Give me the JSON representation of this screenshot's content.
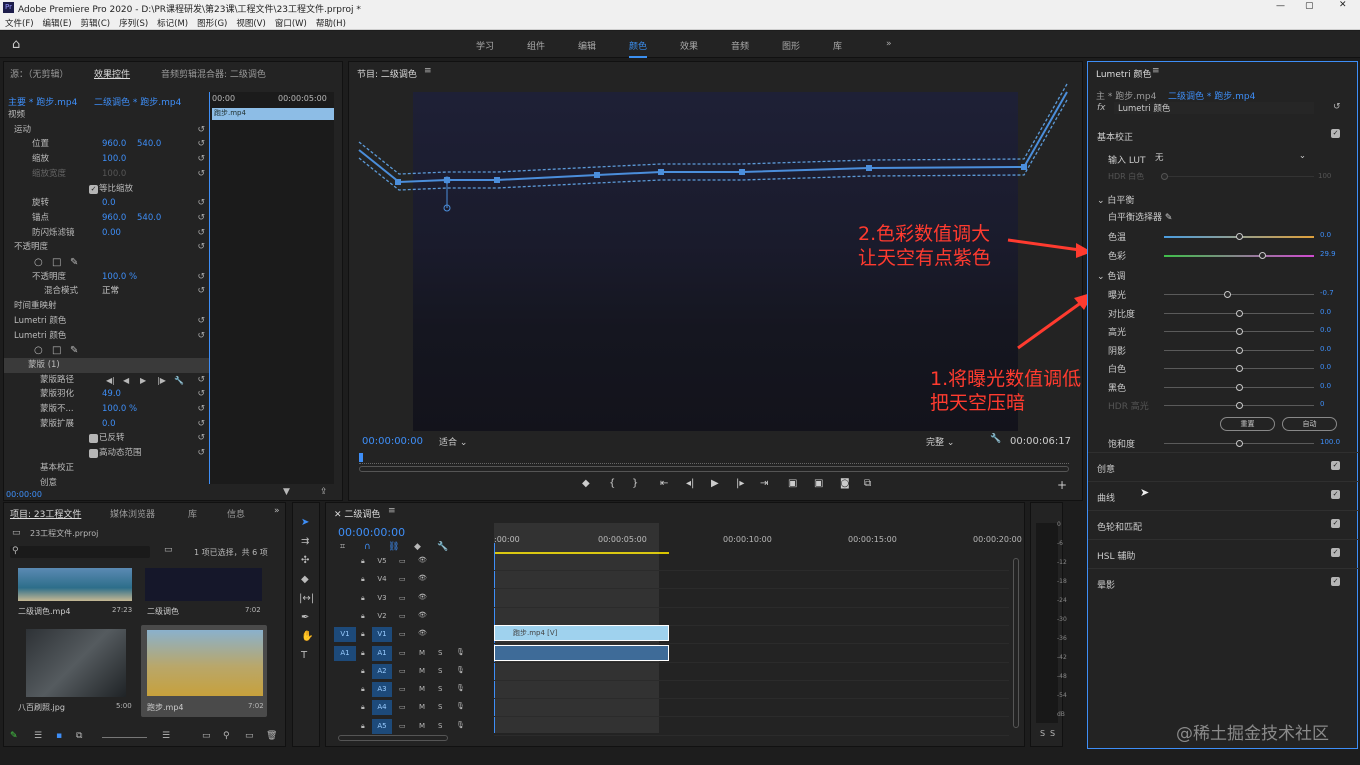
{
  "titlebar": {
    "title": "Adobe Premiere Pro 2020 - D:\\PR课程研发\\第23课\\工程文件\\23工程文件.prproj *"
  },
  "menu": [
    "文件(F)",
    "编辑(E)",
    "剪辑(C)",
    "序列(S)",
    "标记(M)",
    "图形(G)",
    "视图(V)",
    "窗口(W)",
    "帮助(H)"
  ],
  "workspaces": [
    "学习",
    "组件",
    "编辑",
    "颜色",
    "效果",
    "音频",
    "图形",
    "库"
  ],
  "active_workspace": "颜色",
  "effect_controls": {
    "tabs": [
      "源：（无剪辑）",
      "效果控件",
      "音频剪辑混合器: 二级调色"
    ],
    "master": "主要 * 跑步.mp4",
    "seq": "二级调色 * 跑步.mp4",
    "time_start": "00:00",
    "time_end": "00:00:05:00",
    "clip": "跑步.mp4",
    "rows": [
      {
        "label": "视频",
        "v1": "",
        "v2": ""
      },
      {
        "label": "运动",
        "v1": "",
        "v2": ""
      },
      {
        "label": "位置",
        "v1": "960.0",
        "v2": "540.0"
      },
      {
        "label": "缩放",
        "v1": "100.0",
        "v2": ""
      },
      {
        "label": "缩放宽度",
        "v1": "100.0",
        "v2": ""
      },
      {
        "label": "等比缩放",
        "v1": "",
        "v2": ""
      },
      {
        "label": "旋转",
        "v1": "0.0",
        "v2": ""
      },
      {
        "label": "锚点",
        "v1": "960.0",
        "v2": "540.0"
      },
      {
        "label": "防闪烁滤镜",
        "v1": "0.00",
        "v2": ""
      },
      {
        "label": "不透明度",
        "v1": "",
        "v2": ""
      },
      {
        "label": "",
        "v1": "",
        "v2": ""
      },
      {
        "label": "不透明度",
        "v1": "100.0 %",
        "v2": ""
      },
      {
        "label": "混合模式",
        "v1": "正常",
        "v2": ""
      },
      {
        "label": "时间重映射",
        "v1": "",
        "v2": ""
      },
      {
        "label": "Lumetri 颜色",
        "v1": "",
        "v2": ""
      },
      {
        "label": "Lumetri 颜色",
        "v1": "",
        "v2": ""
      },
      {
        "label": "",
        "v1": "",
        "v2": ""
      },
      {
        "label": "蒙版 (1)",
        "v1": "",
        "v2": ""
      },
      {
        "label": "蒙版路径",
        "v1": "",
        "v2": ""
      },
      {
        "label": "蒙版羽化",
        "v1": "49.0",
        "v2": ""
      },
      {
        "label": "蒙版不...",
        "v1": "100.0 %",
        "v2": ""
      },
      {
        "label": "蒙版扩展",
        "v1": "0.0",
        "v2": ""
      },
      {
        "label": "已反转",
        "v1": "",
        "v2": ""
      },
      {
        "label": "高动态范围",
        "v1": "",
        "v2": ""
      },
      {
        "label": "基本校正",
        "v1": "",
        "v2": ""
      },
      {
        "label": "创意",
        "v1": "",
        "v2": ""
      }
    ],
    "timecode": "00:00:00"
  },
  "program": {
    "tab": "节目: 二级调色",
    "timecode": "00:00:00:00",
    "fit": "适合",
    "quality": "完整",
    "duration": "00:00:06:17"
  },
  "project": {
    "tabs": [
      "项目: 23工程文件",
      "媒体浏览器",
      "库",
      "信息"
    ],
    "file": "23工程文件.prproj",
    "selection": "1 项已选择，共 6 项",
    "items": [
      {
        "name": "二级调色.mp4",
        "dur": "27:23"
      },
      {
        "name": "二级调色",
        "dur": "7:02"
      },
      {
        "name": "八百刷照.jpg",
        "dur": "5:00"
      },
      {
        "name": "跑步.mp4",
        "dur": "7:02"
      }
    ]
  },
  "timeline": {
    "tab": "二级调色",
    "timecode": "00:00:00:00",
    "ruler": [
      ":00:00",
      "00:00:05:00",
      "00:00:10:00",
      "00:00:15:00",
      "00:00:20:00"
    ],
    "vtracks": [
      "V5",
      "V4",
      "V3",
      "V2",
      "V1"
    ],
    "atracks": [
      "A1",
      "A2",
      "A3",
      "A4",
      "A5"
    ],
    "clip_v": "跑步.mp4 [V]",
    "src_v": "V1",
    "src_a": "A1"
  },
  "meter": {
    "scale": [
      "0",
      "-6",
      "-12",
      "-18",
      "-24",
      "-30",
      "-36",
      "-42",
      "-48",
      "-54",
      "dB"
    ],
    "btns": [
      "S",
      "S"
    ]
  },
  "lumetri": {
    "title": "Lumetri 颜色",
    "master": "主 * 跑步.mp4",
    "seq": "二级调色 * 跑步.mp4",
    "fx": "Lumetri 颜色",
    "basic": "基本校正",
    "lut_label": "输入 LUT",
    "lut_value": "无",
    "hdr_white": "HDR 白色",
    "hdr_white_val": "100",
    "wb": "白平衡",
    "wb_picker": "白平衡选择器",
    "temp": {
      "label": "色温",
      "value": "0.0",
      "level": 0.5
    },
    "tint": {
      "label": "色彩",
      "value": "29.9",
      "level": 0.65
    },
    "tone": "色调",
    "sliders": [
      {
        "label": "曝光",
        "value": "-0.7",
        "level": 0.42
      },
      {
        "label": "对比度",
        "value": "0.0",
        "level": 0.5
      },
      {
        "label": "高光",
        "value": "0.0",
        "level": 0.5
      },
      {
        "label": "阴影",
        "value": "0.0",
        "level": 0.5
      },
      {
        "label": "白色",
        "value": "0.0",
        "level": 0.5
      },
      {
        "label": "黑色",
        "value": "0.0",
        "level": 0.5
      },
      {
        "label": "HDR 高光",
        "value": "0",
        "level": 0.5
      }
    ],
    "reset": "重置",
    "auto": "自动",
    "sat": {
      "label": "饱和度",
      "value": "100.0",
      "level": 0.5
    },
    "sections": [
      "创意",
      "曲线",
      "色轮和匹配",
      "HSL 辅助",
      "晕影"
    ]
  },
  "annotations": {
    "a2_1": "2.色彩数值调大",
    "a2_2": "让天空有点紫色",
    "a1_1": "1.将曝光数值调低",
    "a1_2": "把天空压暗"
  },
  "watermark": "@稀土掘金技术社区",
  "colors": {
    "accent": "#3e8ef7",
    "annotation": "#ff3b2f",
    "temp_start": "#4a9de0",
    "temp_end": "#e0a03a",
    "tint_start": "#3fbf4a",
    "tint_end": "#d04ad0"
  }
}
